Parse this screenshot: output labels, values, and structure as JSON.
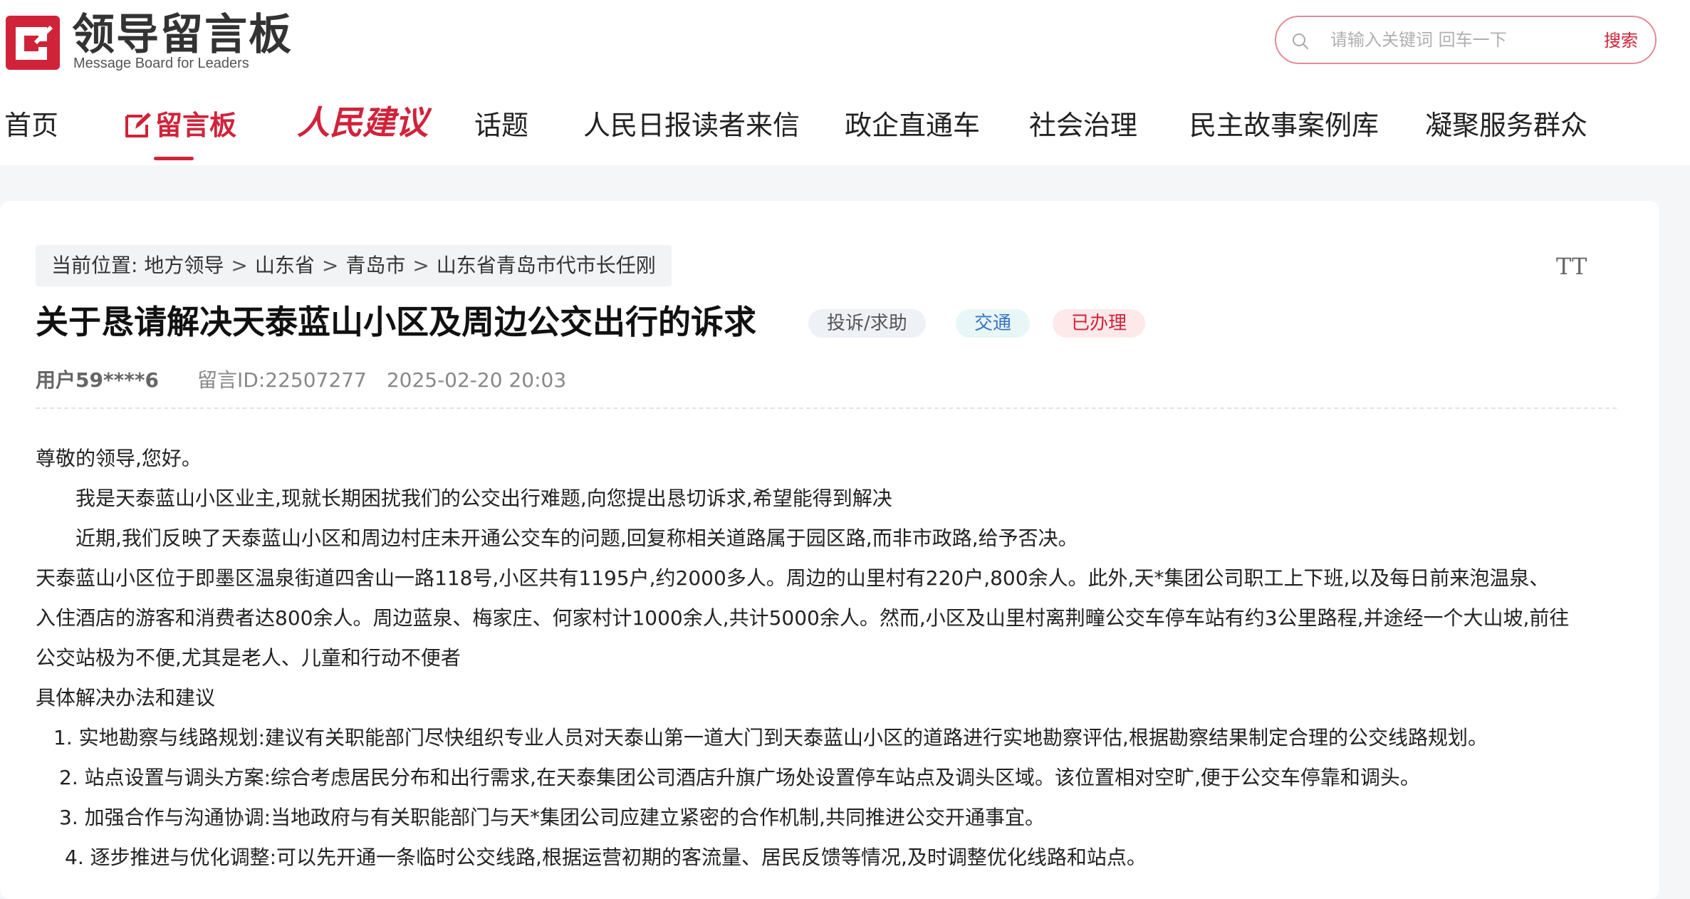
{
  "header": {
    "logo_cn": "领导留言板",
    "logo_en": "Message Board for Leaders",
    "search": {
      "placeholder": "请输入关键词 回车一下",
      "button": "搜索"
    }
  },
  "nav": {
    "items": [
      "首页",
      "留言板",
      "人民建议",
      "话题",
      "人民日报读者来信",
      "政企直通车",
      "社会治理",
      "民主故事案例库",
      "凝聚服务群众"
    ],
    "active_index": 1
  },
  "colors": {
    "brand_red": "#d0233a",
    "tag_topic_text": "#3574c4"
  },
  "icons": [
    "logo-icon",
    "search-icon",
    "edit-icon",
    "font-size-icon"
  ],
  "breadcrumb": {
    "label": "当前位置:",
    "items": [
      "地方领导",
      "山东省",
      "青岛市",
      "山东省青岛市代市长任刚"
    ],
    "separator": ">"
  },
  "font_size_toggle": "TT",
  "message": {
    "title": "关于恳请解决天泰蓝山小区及周边公交出行的诉求",
    "tags": [
      "投诉/求助",
      "交通",
      "已办理"
    ],
    "author": "用户59****6",
    "message_id": "留言ID:22507277",
    "datetime": "2025-02-20 20:03",
    "body": [
      "尊敬的领导,您好。",
      "我是天泰蓝山小区业主,现就长期困扰我们的公交出行难题,向您提出恳切诉求,希望能得到解决",
      "近期,我们反映了天泰蓝山小区和周边村庄未开通公交车的问题,回复称相关道路属于园区路,而非市政路,给予否决。",
      "天泰蓝山小区位于即墨区温泉街道四舍山一路118号,小区共有1195户,约2000多人。周边的山里村有220户,800余人。此外,天*集团公司职工上下班,以及每日前来泡温泉、",
      "入住酒店的游客和消费者达800余人。周边蓝泉、梅家庄、何家村计1000余人,共计5000余人。然而,小区及山里村离荆疃公交车停车站有约3公里路程,并途经一个大山坡,前往",
      "公交站极为不便,尤其是老人、儿童和行动不便者",
      "具体解决办法和建议",
      "1. 实地勘察与线路规划:建议有关职能部门尽快组织专业人员对天泰山第一道大门到天泰蓝山小区的道路进行实地勘察评估,根据勘察结果制定合理的公交线路规划。",
      "2. 站点设置与调头方案:综合考虑居民分布和出行需求,在天泰集团公司酒店升旗广场处设置停车站点及调头区域。该位置相对空旷,便于公交车停靠和调头。",
      "3. 加强合作与沟通协调:当地政府与有关职能部门与天*集团公司应建立紧密的合作机制,共同推进公交开通事宜。",
      "4. 逐步推进与优化调整:可以先开通一条临时公交线路,根据运营初期的客流量、居民反馈等情况,及时调整优化线路和站点。"
    ]
  }
}
